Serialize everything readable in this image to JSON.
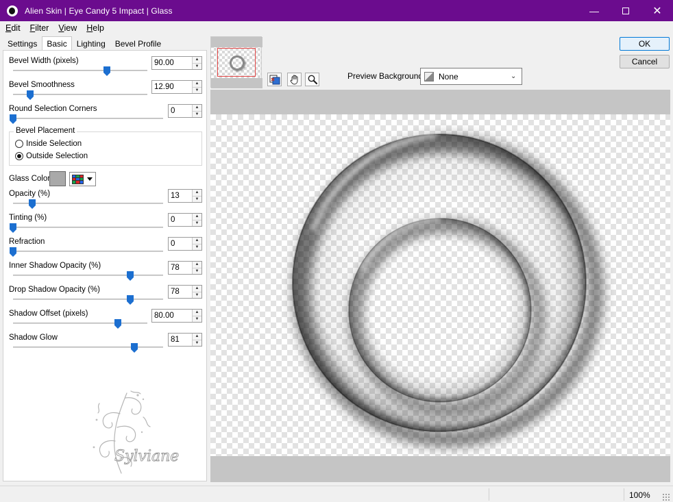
{
  "window": {
    "title": "Alien Skin | Eye Candy 5 Impact | Glass"
  },
  "menu": [
    {
      "label": "Edit",
      "mn": "E",
      "rest": "dit"
    },
    {
      "label": "Filter",
      "mn": "F",
      "rest": "ilter"
    },
    {
      "label": "View",
      "mn": "V",
      "rest": "iew"
    },
    {
      "label": "Help",
      "mn": "H",
      "rest": "elp"
    }
  ],
  "tabs": [
    "Settings",
    "Basic",
    "Lighting",
    "Bevel Profile"
  ],
  "active_tab": "Basic",
  "controls": {
    "bevel_width": {
      "label": "Bevel Width (pixels)",
      "value": "90.00",
      "fraction": 0.7
    },
    "bevel_smoothness": {
      "label": "Bevel Smoothness",
      "value": "12.90",
      "fraction": 0.13
    },
    "round_corners": {
      "label": "Round Selection Corners",
      "value": "0",
      "fraction": 0.0
    },
    "opacity": {
      "label": "Opacity (%)",
      "value": "13",
      "fraction": 0.13
    },
    "tinting": {
      "label": "Tinting (%)",
      "value": "0",
      "fraction": 0.0
    },
    "refraction": {
      "label": "Refraction",
      "value": "0",
      "fraction": 0.0
    },
    "inner_shadow_opacity": {
      "label": "Inner Shadow Opacity (%)",
      "value": "78",
      "fraction": 0.78
    },
    "drop_shadow_opacity": {
      "label": "Drop Shadow Opacity (%)",
      "value": "78",
      "fraction": 0.78
    },
    "shadow_offset": {
      "label": "Shadow Offset (pixels)",
      "value": "80.00",
      "fraction": 0.78
    },
    "shadow_glow": {
      "label": "Shadow Glow",
      "value": "81",
      "fraction": 0.81
    }
  },
  "bevel_placement": {
    "legend": "Bevel Placement",
    "options": [
      "Inside Selection",
      "Outside Selection"
    ],
    "selected": "Outside Selection"
  },
  "glass_color": {
    "label": "Glass Color",
    "color": "#a9a9a9"
  },
  "watermark": {
    "text": "Sylviane"
  },
  "preview_background": {
    "label": "Preview Background:",
    "value": "None"
  },
  "buttons": {
    "ok": "OK",
    "cancel": "Cancel"
  },
  "status": {
    "zoom": "100%"
  },
  "colors": {
    "titlebar": "#6b0c8e",
    "slider_thumb": "#1c6fd0"
  }
}
